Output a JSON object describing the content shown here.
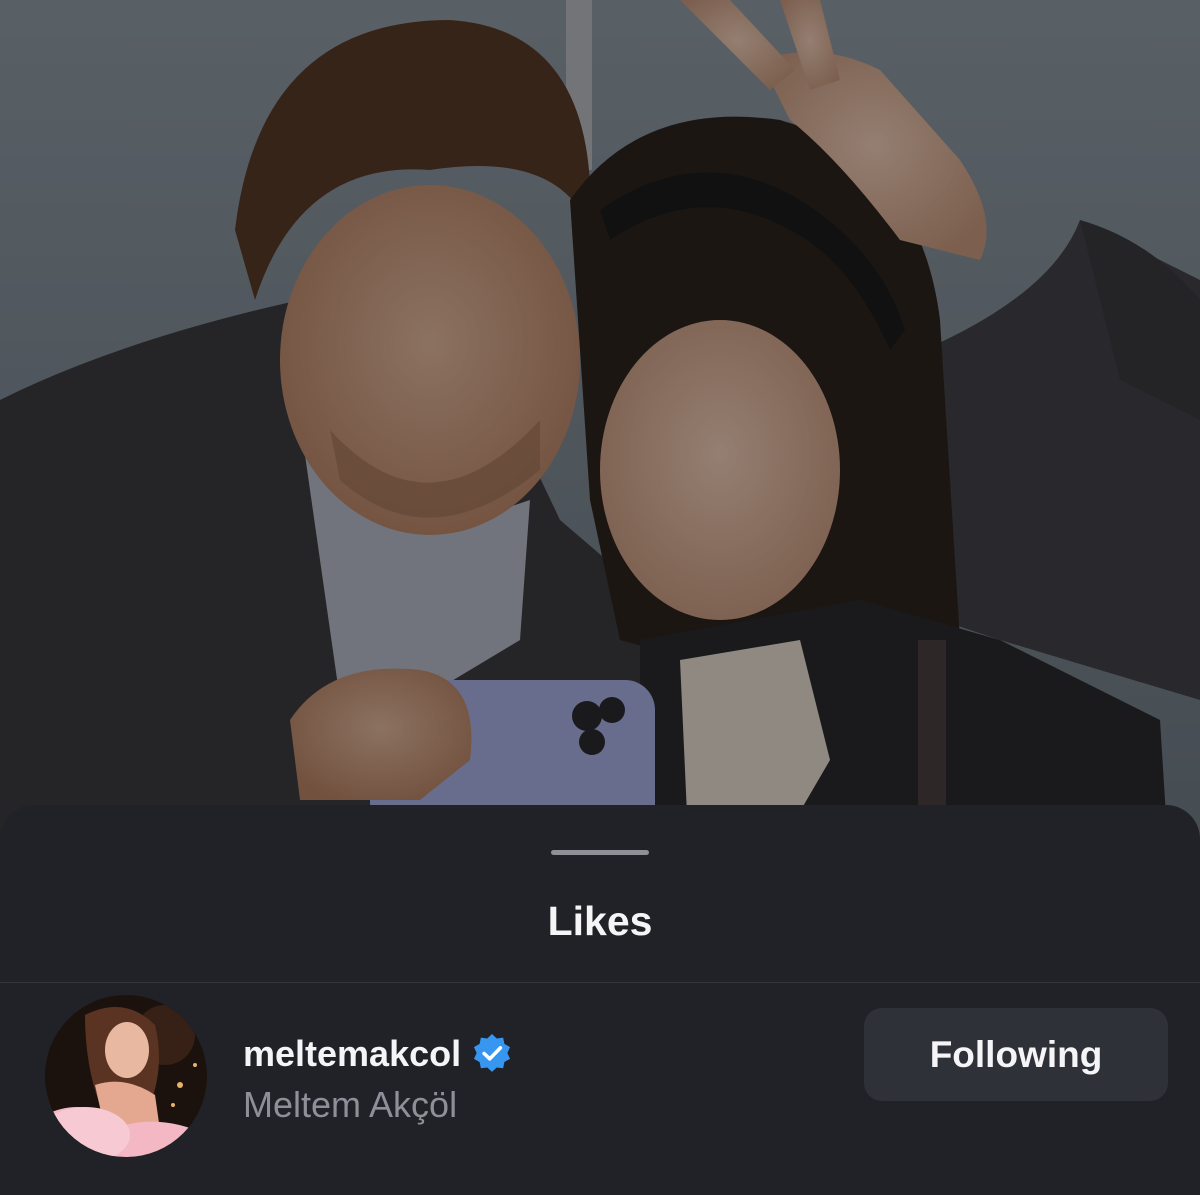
{
  "sheet": {
    "title": "Likes"
  },
  "likes": [
    {
      "username": "meltemakcol",
      "full_name": "Meltem Akçöl",
      "verified": true,
      "button_label": "Following"
    }
  ],
  "colors": {
    "sheet_background": "#212227",
    "button_background": "#2f3138",
    "verified_badge": "#3797f0",
    "secondary_text": "#8d8f99"
  },
  "icons": {
    "verified": "verified-badge-icon"
  }
}
